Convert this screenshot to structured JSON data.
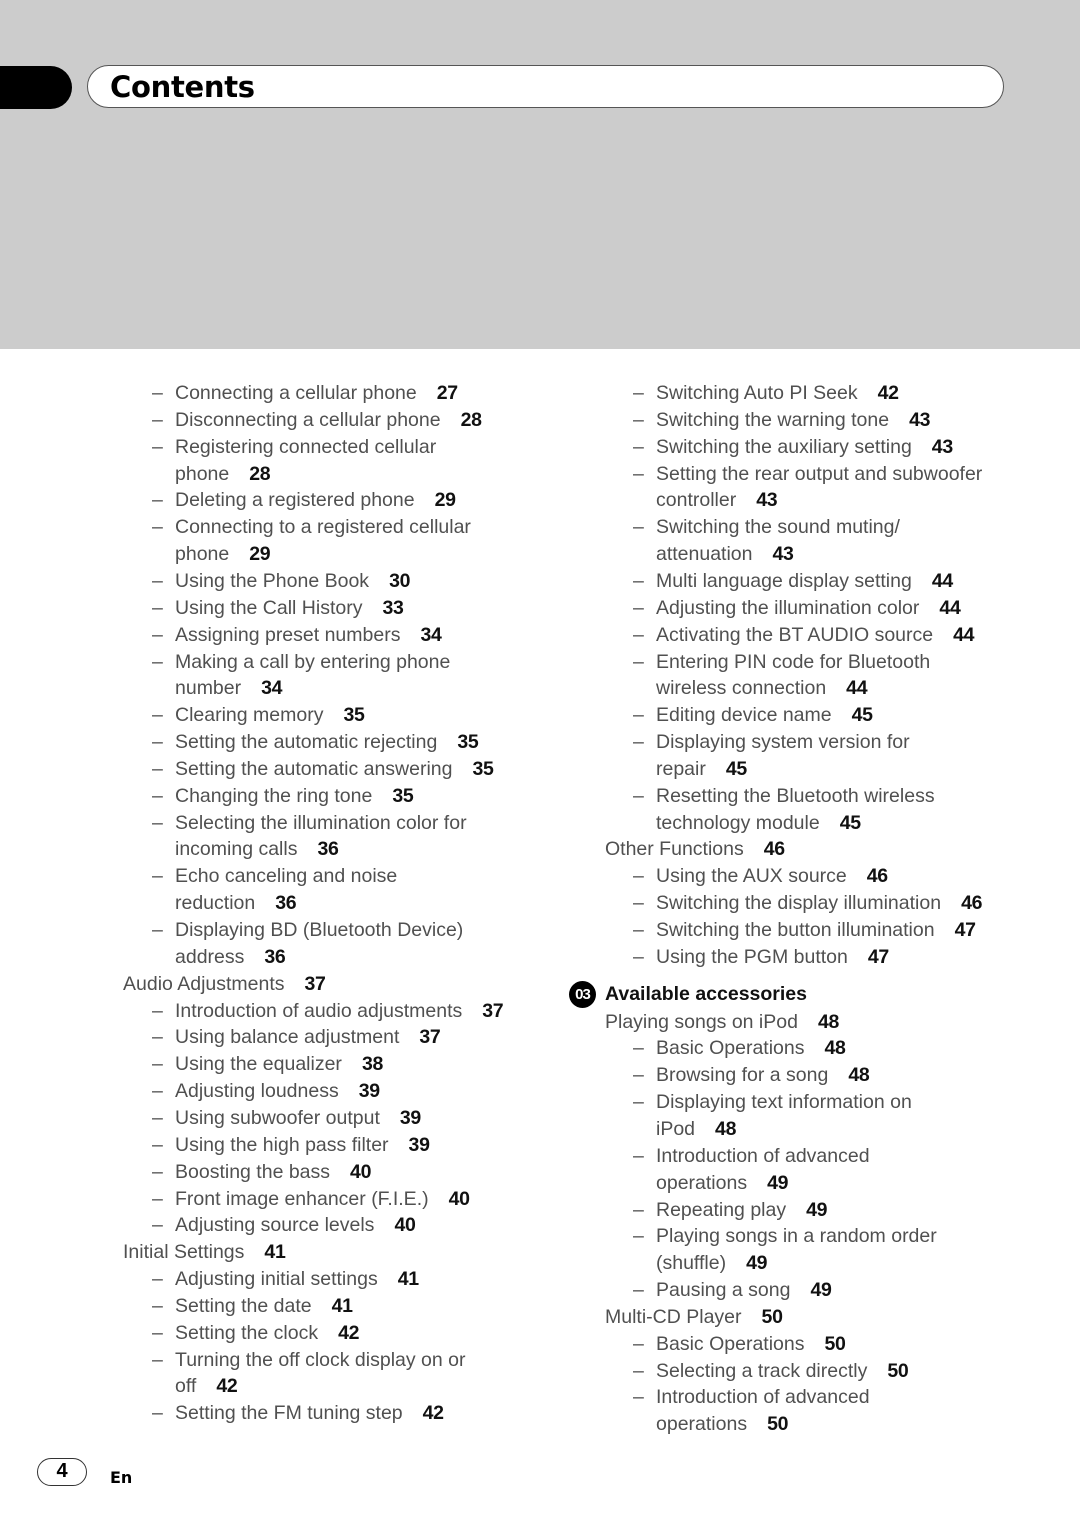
{
  "header": {
    "title": "Contents"
  },
  "left_column": [
    {
      "type": "item",
      "text": "Connecting a cellular phone",
      "page": "27"
    },
    {
      "type": "item",
      "text": "Disconnecting a cellular phone",
      "page": "28"
    },
    {
      "type": "item",
      "text": "Registering connected cellular",
      "cont": "phone",
      "page": "28"
    },
    {
      "type": "item",
      "text": "Deleting a registered phone",
      "page": "29"
    },
    {
      "type": "item",
      "text": "Connecting to a registered cellular",
      "cont": "phone",
      "page": "29"
    },
    {
      "type": "item",
      "text": "Using the Phone Book",
      "page": "30"
    },
    {
      "type": "item",
      "text": "Using the Call History",
      "page": "33"
    },
    {
      "type": "item",
      "text": "Assigning preset numbers",
      "page": "34"
    },
    {
      "type": "item",
      "text": "Making a call by entering phone",
      "cont": "number",
      "page": "34"
    },
    {
      "type": "item",
      "text": "Clearing memory",
      "page": "35"
    },
    {
      "type": "item",
      "text": "Setting the automatic rejecting",
      "page": "35"
    },
    {
      "type": "item",
      "text": "Setting the automatic answering",
      "page": "35"
    },
    {
      "type": "item",
      "text": "Changing the ring tone",
      "page": "35"
    },
    {
      "type": "item",
      "text": "Selecting the illumination color for",
      "cont": "incoming calls",
      "page": "36"
    },
    {
      "type": "item",
      "text": "Echo canceling and noise",
      "cont": "reduction",
      "page": "36"
    },
    {
      "type": "item",
      "text": "Displaying BD (Bluetooth Device)",
      "cont": "address",
      "page": "36"
    },
    {
      "type": "section",
      "text": "Audio Adjustments",
      "page": "37"
    },
    {
      "type": "item",
      "text": "Introduction of audio adjustments",
      "page": "37"
    },
    {
      "type": "item",
      "text": "Using balance adjustment",
      "page": "37"
    },
    {
      "type": "item",
      "text": "Using the equalizer",
      "page": "38"
    },
    {
      "type": "item",
      "text": "Adjusting loudness",
      "page": "39"
    },
    {
      "type": "item",
      "text": "Using subwoofer output",
      "page": "39"
    },
    {
      "type": "item",
      "text": "Using the high pass filter",
      "page": "39"
    },
    {
      "type": "item",
      "text": "Boosting the bass",
      "page": "40"
    },
    {
      "type": "item",
      "text": "Front image enhancer (F.I.E.)",
      "page": "40"
    },
    {
      "type": "item",
      "text": "Adjusting source levels",
      "page": "40"
    },
    {
      "type": "section",
      "text": "Initial Settings",
      "page": "41"
    },
    {
      "type": "item",
      "text": "Adjusting initial settings",
      "page": "41"
    },
    {
      "type": "item",
      "text": "Setting the date",
      "page": "41"
    },
    {
      "type": "item",
      "text": "Setting the clock",
      "page": "42"
    },
    {
      "type": "item",
      "text": "Turning the off clock display on or",
      "cont": "off",
      "page": "42"
    },
    {
      "type": "item",
      "text": "Setting the FM tuning step",
      "page": "42"
    }
  ],
  "right_column": [
    {
      "type": "item",
      "text": "Switching Auto PI Seek",
      "page": "42"
    },
    {
      "type": "item",
      "text": "Switching the warning tone",
      "page": "43"
    },
    {
      "type": "item",
      "text": "Switching the auxiliary setting",
      "page": "43"
    },
    {
      "type": "item",
      "text": "Setting the rear output and subwoofer",
      "cont": "controller",
      "page": "43"
    },
    {
      "type": "item",
      "text": "Switching the sound muting/",
      "cont": "attenuation",
      "page": "43"
    },
    {
      "type": "item",
      "text": "Multi language display setting",
      "page": "44"
    },
    {
      "type": "item",
      "text": "Adjusting the illumination color",
      "page": "44"
    },
    {
      "type": "item",
      "text": "Activating the BT AUDIO source",
      "page": "44"
    },
    {
      "type": "item",
      "text": "Entering PIN code for Bluetooth",
      "cont": "wireless connection",
      "page": "44"
    },
    {
      "type": "item",
      "text": "Editing device name",
      "page": "45"
    },
    {
      "type": "item",
      "text": "Displaying system version for",
      "cont": "repair",
      "page": "45"
    },
    {
      "type": "item",
      "text": "Resetting the Bluetooth wireless",
      "cont": "technology module",
      "page": "45"
    },
    {
      "type": "section",
      "text": "Other Functions",
      "page": "46"
    },
    {
      "type": "item",
      "text": "Using the AUX source",
      "page": "46"
    },
    {
      "type": "item",
      "text": "Switching the display illumination",
      "page": "46"
    },
    {
      "type": "item",
      "text": "Switching the button illumination",
      "page": "47"
    },
    {
      "type": "item",
      "text": "Using the PGM button",
      "page": "47"
    },
    {
      "type": "chapter",
      "number": "03",
      "text": "Available accessories"
    },
    {
      "type": "section",
      "text": "Playing songs on iPod",
      "page": "48"
    },
    {
      "type": "item",
      "text": "Basic Operations",
      "page": "48"
    },
    {
      "type": "item",
      "text": "Browsing for a song",
      "page": "48"
    },
    {
      "type": "item",
      "text": "Displaying text information on",
      "cont": "iPod",
      "page": "48"
    },
    {
      "type": "item",
      "text": "Introduction of advanced",
      "cont": "operations",
      "page": "49"
    },
    {
      "type": "item",
      "text": "Repeating play",
      "page": "49"
    },
    {
      "type": "item",
      "text": "Playing songs in a random order",
      "cont": "(shuffle)",
      "page": "49"
    },
    {
      "type": "item",
      "text": "Pausing a song",
      "page": "49"
    },
    {
      "type": "section",
      "text": "Multi-CD Player",
      "page": "50"
    },
    {
      "type": "item",
      "text": "Basic Operations",
      "page": "50"
    },
    {
      "type": "item",
      "text": "Selecting a track directly",
      "page": "50"
    },
    {
      "type": "item",
      "text": "Introduction of advanced",
      "cont": "operations",
      "page": "50"
    }
  ],
  "footer": {
    "page_number": "4",
    "language": "En",
    "dash": "–"
  }
}
